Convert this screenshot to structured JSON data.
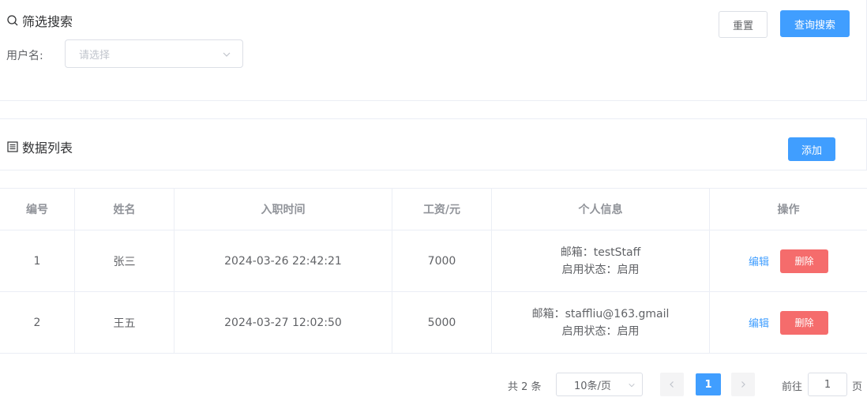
{
  "search_panel": {
    "title": "筛选搜索",
    "reset_label": "重置",
    "search_label": "查询搜索",
    "username_label": "用户名:",
    "username_placeholder": "请选择"
  },
  "list_panel": {
    "title": "数据列表",
    "add_label": "添加"
  },
  "table": {
    "headers": [
      "编号",
      "姓名",
      "入职时间",
      "工资/元",
      "个人信息",
      "操作"
    ],
    "rows": [
      {
        "id": "1",
        "name": "张三",
        "hire_time": "2024-03-26 22:42:21",
        "salary": "7000",
        "email": "邮箱：testStaff",
        "status": "启用状态：启用",
        "edit": "编辑",
        "delete": "删除"
      },
      {
        "id": "2",
        "name": "王五",
        "hire_time": "2024-03-27 12:02:50",
        "salary": "5000",
        "email": "邮箱：staffliu@163.gmail",
        "status": "启用状态：启用",
        "edit": "编辑",
        "delete": "删除"
      }
    ]
  },
  "pagination": {
    "total": "共 2 条",
    "page_size": "10条/页",
    "current_page": "1",
    "goto_label": "前往",
    "goto_value": "1",
    "goto_unit": "页"
  },
  "colors": {
    "primary": "#409eff",
    "danger": "#f56c6c",
    "border": "#ebeef5"
  }
}
